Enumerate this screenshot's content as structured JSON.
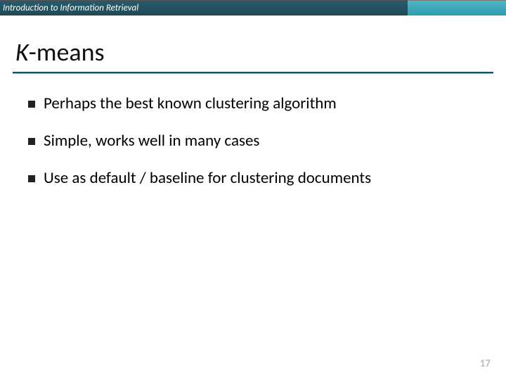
{
  "header": {
    "course": "Introduction to Information Retrieval"
  },
  "title": {
    "k": "K",
    "rest": "-means"
  },
  "bullets": [
    "Perhaps the best known clustering algorithm",
    "Simple, works well in many cases",
    "Use as default / baseline for clustering documents"
  ],
  "page_number": "17"
}
